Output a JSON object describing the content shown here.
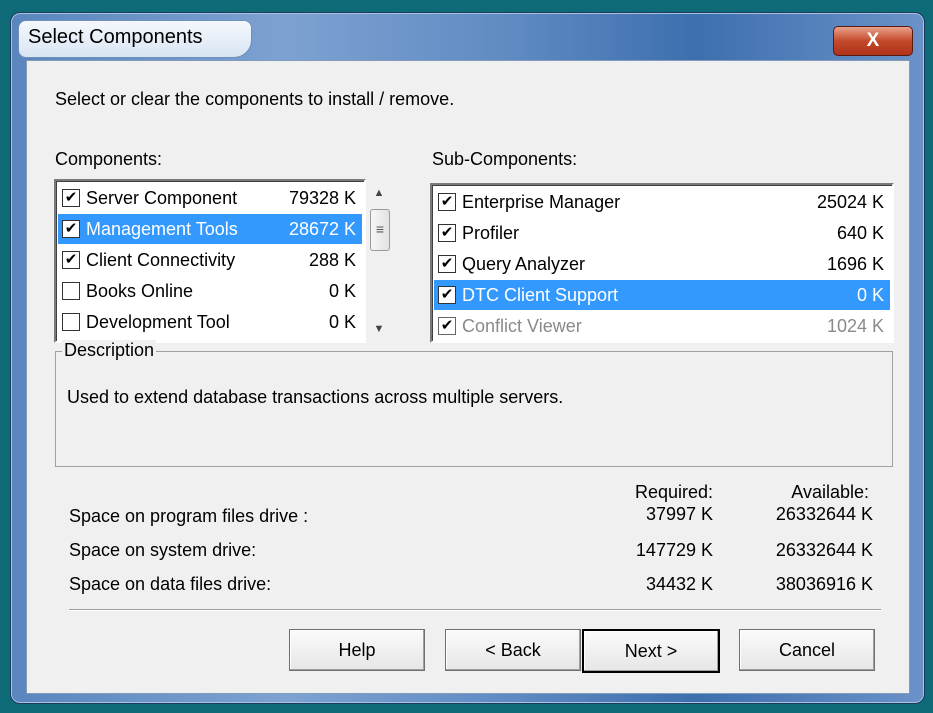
{
  "window": {
    "title": "Select Components",
    "close_label": "X"
  },
  "instruction": "Select or clear the components to install / remove.",
  "components": {
    "label": "Components:",
    "items": [
      {
        "name": "Server Component",
        "size": "79328 K",
        "checked": true,
        "selected": false
      },
      {
        "name": "Management Tools",
        "size": "28672 K",
        "checked": true,
        "selected": true
      },
      {
        "name": "Client Connectivity",
        "size": "288 K",
        "checked": true,
        "selected": false
      },
      {
        "name": "Books Online",
        "size": "0 K",
        "checked": false,
        "selected": false
      },
      {
        "name": "Development Tool",
        "size": "0 K",
        "checked": false,
        "selected": false
      }
    ]
  },
  "subcomponents": {
    "label": "Sub-Components:",
    "items": [
      {
        "name": "Enterprise Manager",
        "size": "25024 K",
        "checked": true,
        "selected": false,
        "disabled": false
      },
      {
        "name": "Profiler",
        "size": "640 K",
        "checked": true,
        "selected": false,
        "disabled": false
      },
      {
        "name": "Query Analyzer",
        "size": "1696 K",
        "checked": true,
        "selected": false,
        "disabled": false
      },
      {
        "name": "DTC Client Support",
        "size": "0 K",
        "checked": true,
        "selected": true,
        "disabled": false
      },
      {
        "name": "Conflict Viewer",
        "size": "1024 K",
        "checked": true,
        "selected": false,
        "disabled": true
      }
    ]
  },
  "description": {
    "label": "Description",
    "text": "Used to extend database transactions across multiple servers."
  },
  "space": {
    "required_header": "Required:",
    "available_header": "Available:",
    "rows": [
      {
        "label": "Space on program files drive :",
        "required": "37997 K",
        "available": "26332644 K"
      },
      {
        "label": "Space on system drive:",
        "required": "147729 K",
        "available": "26332644 K"
      },
      {
        "label": "Space on data files drive:",
        "required": "34432 K",
        "available": "38036916 K"
      }
    ]
  },
  "buttons": {
    "help": "Help",
    "back": "< Back",
    "next": "Next >",
    "cancel": "Cancel"
  },
  "colors": {
    "selection": "#3399ff",
    "close_button": "#c4492b",
    "desktop": "#0e6a77"
  },
  "icons": {
    "checkbox": "checkmark-icon",
    "scroll_up": "arrow-up-icon",
    "scroll_down": "arrow-down-icon",
    "thumb": "grip-icon"
  }
}
